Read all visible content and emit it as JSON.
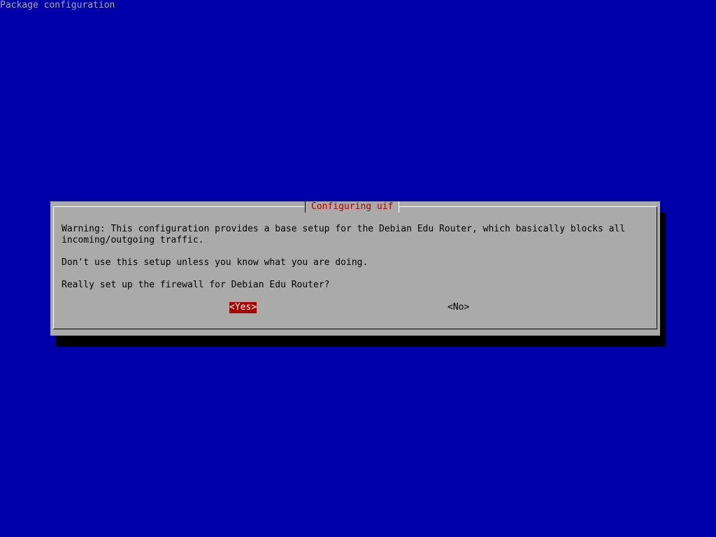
{
  "screen": {
    "title": "Package configuration"
  },
  "dialog": {
    "title": "Configuring uif",
    "lines": [
      "Warning: This configuration provides a base setup for the Debian Edu Router, which basically blocks all",
      "incoming/outgoing traffic.",
      "",
      "Don't use this setup unless you know what you are doing.",
      "",
      "Really set up the firewall for Debian Edu Router?"
    ],
    "buttons": {
      "yes": "<Yes>",
      "no": "<No>"
    },
    "selected_button": "yes"
  },
  "colors": {
    "background": "#0000aa",
    "dialog": "#aaaaaa",
    "title_text": "#aa0000",
    "selected_button": "#aa0000"
  }
}
